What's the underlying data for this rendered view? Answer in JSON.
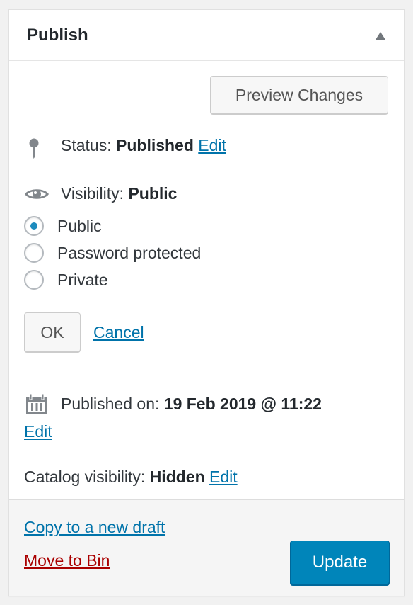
{
  "panel": {
    "title": "Publish",
    "toggle_icon": "triangle-up-icon"
  },
  "preview_button": "Preview Changes",
  "status": {
    "icon": "pin-icon",
    "label": "Status:",
    "value": "Published",
    "edit_link": "Edit"
  },
  "visibility": {
    "icon": "eye-icon",
    "label": "Visibility:",
    "value": "Public",
    "options": [
      {
        "label": "Public",
        "checked": true
      },
      {
        "label": "Password protected",
        "checked": false
      },
      {
        "label": "Private",
        "checked": false
      }
    ],
    "ok_button": "OK",
    "cancel_link": "Cancel"
  },
  "published_on": {
    "icon": "calendar-icon",
    "label": "Published on:",
    "value": "19 Feb 2019 @ 11:22",
    "edit_link": "Edit"
  },
  "catalog_visibility": {
    "label": "Catalog visibility:",
    "value": "Hidden",
    "edit_link": "Edit"
  },
  "footer": {
    "copy_link": "Copy to a new draft",
    "trash_link": "Move to Bin",
    "update_button": "Update"
  },
  "colors": {
    "link": "#0073aa",
    "danger": "#aa0000",
    "primary_button": "#0085ba",
    "radio_checked": "#1e8cbe"
  }
}
